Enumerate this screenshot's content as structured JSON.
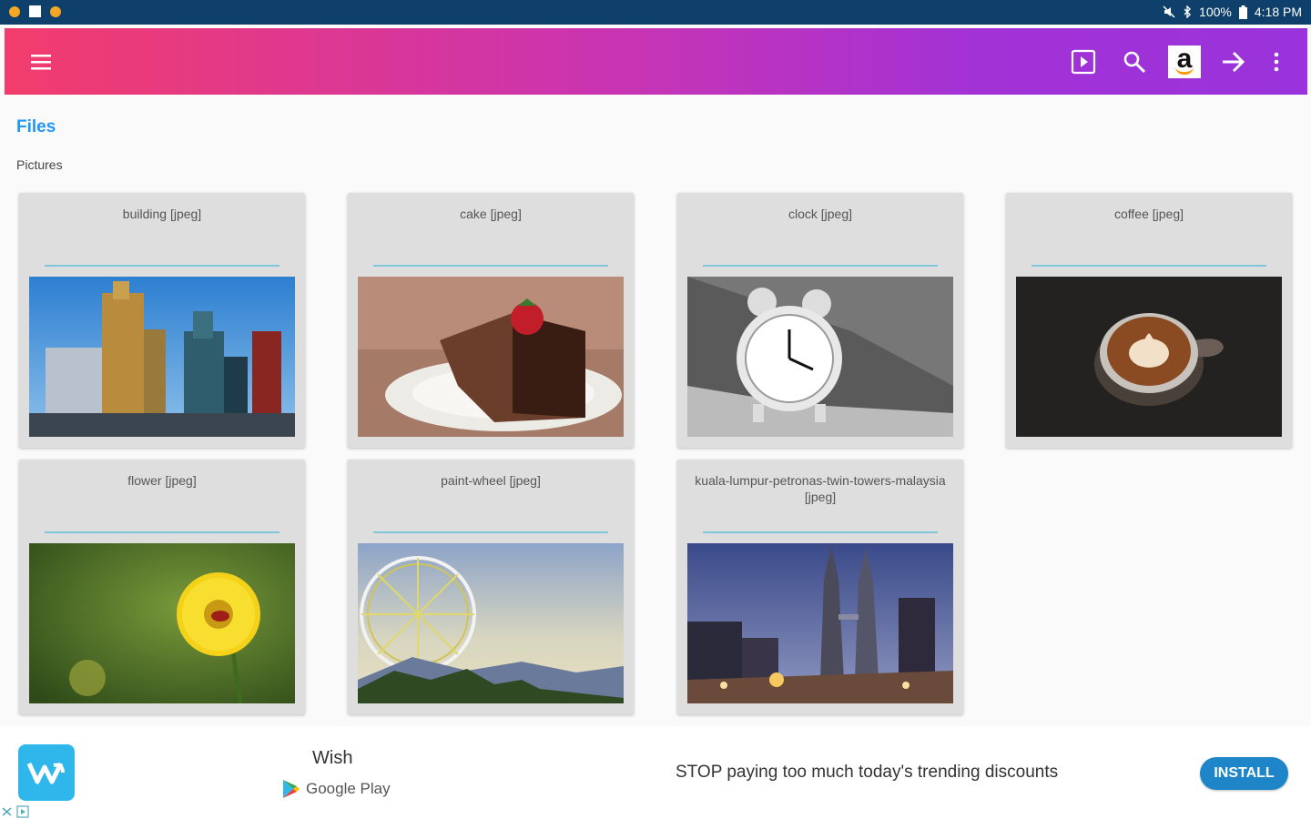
{
  "status_bar": {
    "battery": "100%",
    "time": "4:18 PM"
  },
  "toolbar": {
    "menu_icon": "hamburger-icon",
    "icons": [
      "slideshow-icon",
      "search-icon",
      "amazon-icon",
      "arrow-right-icon",
      "more-vert-icon"
    ],
    "amazon_letter": "a"
  },
  "breadcrumb": {
    "root": "Files",
    "folder": "Pictures"
  },
  "files": [
    {
      "title": "building [jpeg]",
      "image": "building"
    },
    {
      "title": "cake [jpeg]",
      "image": "cake"
    },
    {
      "title": "clock [jpeg]",
      "image": "clock"
    },
    {
      "title": "coffee [jpeg]",
      "image": "coffee"
    },
    {
      "title": "flower [jpeg]",
      "image": "flower"
    },
    {
      "title": "paint-wheel [jpeg]",
      "image": "ferris-wheel"
    },
    {
      "title": "kuala-lumpur-petronas-twin-towers-malaysia [jpeg]",
      "image": "petronas-towers"
    }
  ],
  "ad": {
    "app_name": "Wish",
    "store": "Google Play",
    "headline": "STOP paying too much today's trending discounts",
    "cta": "INSTALL",
    "colors": {
      "logo": "#2fb7ec",
      "button": "#1e86c8"
    }
  },
  "colors": {
    "gradient_start": "#f23c6c",
    "gradient_end": "#9a33db",
    "accent": "#2196f3"
  }
}
